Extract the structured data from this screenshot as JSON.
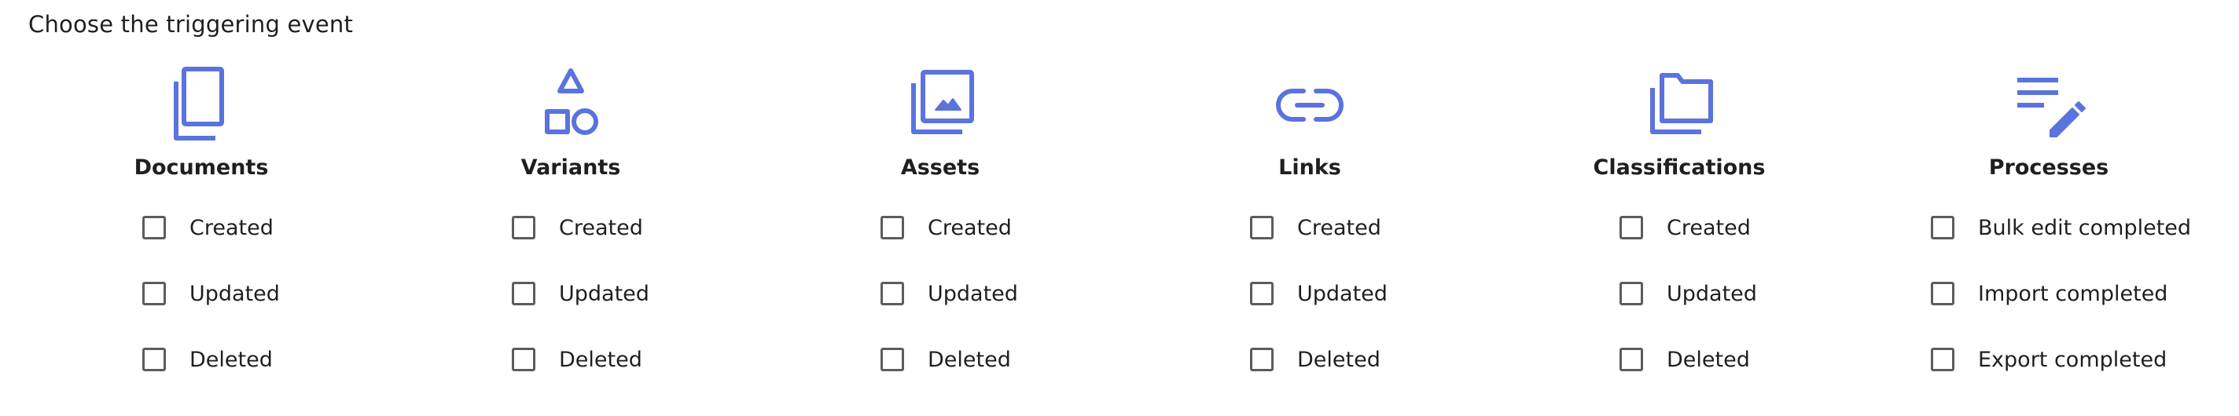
{
  "header": {
    "title": "Choose the triggering event"
  },
  "colors": {
    "accent": "#5b73dc",
    "text": "#1f1f1f",
    "checkbox_border": "#5c5c5c"
  },
  "columns": [
    {
      "title": "Documents",
      "icon": "documents-icon",
      "options": [
        "Created",
        "Updated",
        "Deleted"
      ]
    },
    {
      "title": "Variants",
      "icon": "shapes-icon",
      "options": [
        "Created",
        "Updated",
        "Deleted"
      ]
    },
    {
      "title": "Assets",
      "icon": "image-icon",
      "options": [
        "Created",
        "Updated",
        "Deleted"
      ]
    },
    {
      "title": "Links",
      "icon": "link-icon",
      "options": [
        "Created",
        "Updated",
        "Deleted"
      ]
    },
    {
      "title": "Classifications",
      "icon": "folders-icon",
      "options": [
        "Created",
        "Updated",
        "Deleted"
      ]
    },
    {
      "title": "Processes",
      "icon": "edit-list-icon",
      "options": [
        "Bulk edit completed",
        "Import completed",
        "Export completed"
      ]
    }
  ]
}
